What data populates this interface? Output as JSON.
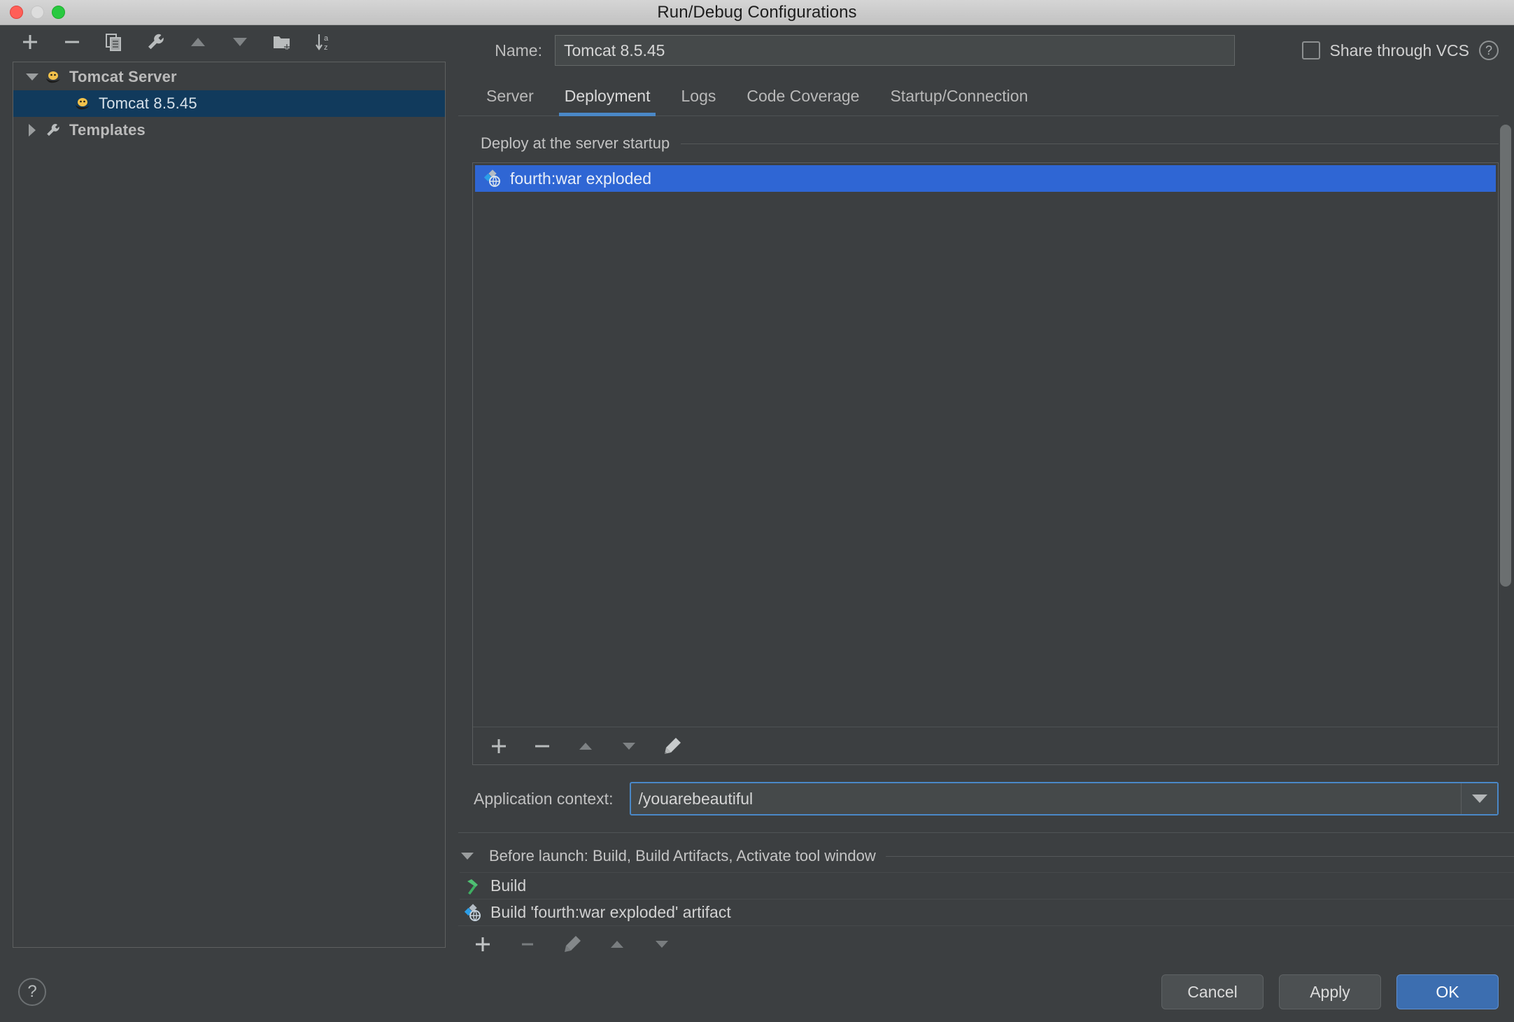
{
  "window": {
    "title": "Run/Debug Configurations",
    "traffic_lights": [
      "close-button",
      "minimize-button",
      "maximize-button"
    ]
  },
  "sidebar": {
    "toolbar": [
      {
        "name": "add-configuration-button",
        "icon": "plus-icon",
        "glyph": "+"
      },
      {
        "name": "remove-configuration-button",
        "icon": "minus-icon",
        "glyph": "−"
      },
      {
        "name": "copy-configuration-button",
        "icon": "copy-icon",
        "glyph": "⧉"
      },
      {
        "name": "edit-templates-button",
        "icon": "wrench-icon",
        "glyph": "🔧"
      },
      {
        "name": "move-up-button",
        "icon": "triangle-up-icon",
        "glyph": "▲"
      },
      {
        "name": "move-down-button",
        "icon": "triangle-down-icon",
        "glyph": "▼"
      },
      {
        "name": "move-into-folder-button",
        "icon": "folder-add-icon",
        "glyph": "🗀"
      },
      {
        "name": "sort-configurations-button",
        "icon": "sort-az-icon",
        "glyph": "↓az"
      }
    ],
    "tree": [
      {
        "label": "Tomcat Server",
        "level": 1,
        "expanded": true,
        "icon": "tomcat-icon",
        "selected": false
      },
      {
        "label": "Tomcat 8.5.45",
        "level": 2,
        "expanded": null,
        "icon": "tomcat-icon",
        "selected": true
      },
      {
        "label": "Templates",
        "level": 1,
        "expanded": false,
        "icon": "wrench-icon",
        "selected": false
      }
    ]
  },
  "header": {
    "name_label": "Name:",
    "name_value": "Tomcat 8.5.45",
    "name_placeholder": "",
    "share_vcs_label": "Share through VCS",
    "share_vcs_checked": false,
    "help_icon": "question-mark-icon"
  },
  "tabs": [
    {
      "label": "Server",
      "active": false
    },
    {
      "label": "Deployment",
      "active": true
    },
    {
      "label": "Logs",
      "active": false
    },
    {
      "label": "Code Coverage",
      "active": false
    },
    {
      "label": "Startup/Connection",
      "active": false
    }
  ],
  "deployment": {
    "group_title": "Deploy at the server startup",
    "items": [
      {
        "label": "fourth:war exploded",
        "icon": "artifact-icon",
        "selected": true
      }
    ],
    "toolbar": [
      {
        "name": "add-artifact-button",
        "icon": "plus-icon",
        "glyph": "+",
        "enabled": true
      },
      {
        "name": "remove-artifact-button",
        "icon": "minus-icon",
        "glyph": "−",
        "enabled": true
      },
      {
        "name": "move-artifact-up-button",
        "icon": "triangle-up-icon",
        "glyph": "▲",
        "enabled": false
      },
      {
        "name": "move-artifact-down-button",
        "icon": "triangle-down-icon",
        "glyph": "▼",
        "enabled": false
      },
      {
        "name": "edit-artifact-button",
        "icon": "pencil-icon",
        "glyph": "✎",
        "enabled": true
      }
    ],
    "application_context_label": "Application context:",
    "application_context_value": "/youarebeautiful",
    "application_context_placeholder": "",
    "dropdown_icon": "chevron-down-icon"
  },
  "before_launch": {
    "header": "Before launch: Build, Build Artifacts, Activate tool window",
    "expanded": true,
    "items": [
      {
        "label": "Build",
        "icon": "hammer-icon"
      },
      {
        "label": "Build 'fourth:war exploded' artifact",
        "icon": "artifact-icon"
      }
    ],
    "toolbar": [
      {
        "name": "add-before-launch-task-button",
        "icon": "plus-icon",
        "glyph": "+",
        "enabled": true
      },
      {
        "name": "remove-before-launch-task-button",
        "icon": "minus-icon",
        "glyph": "−",
        "enabled": false
      },
      {
        "name": "edit-before-launch-task-button",
        "icon": "pencil-icon",
        "glyph": "✎",
        "enabled": false
      },
      {
        "name": "move-task-up-button",
        "icon": "triangle-up-icon",
        "glyph": "▲",
        "enabled": false
      },
      {
        "name": "move-task-down-button",
        "icon": "triangle-down-icon",
        "glyph": "▼",
        "enabled": false
      }
    ]
  },
  "footer": {
    "help_label": "?",
    "cancel_label": "Cancel",
    "apply_label": "Apply",
    "ok_label": "OK"
  },
  "colors": {
    "dialog_bg": "#3c3f41",
    "titlebar_bg": "#cccccc",
    "tab_accent": "#4a88c7",
    "selection_blue": "#2f66d4",
    "tree_selection": "#113a5c",
    "primary_button": "#3c6eb0",
    "text": "#d2d2d2"
  }
}
